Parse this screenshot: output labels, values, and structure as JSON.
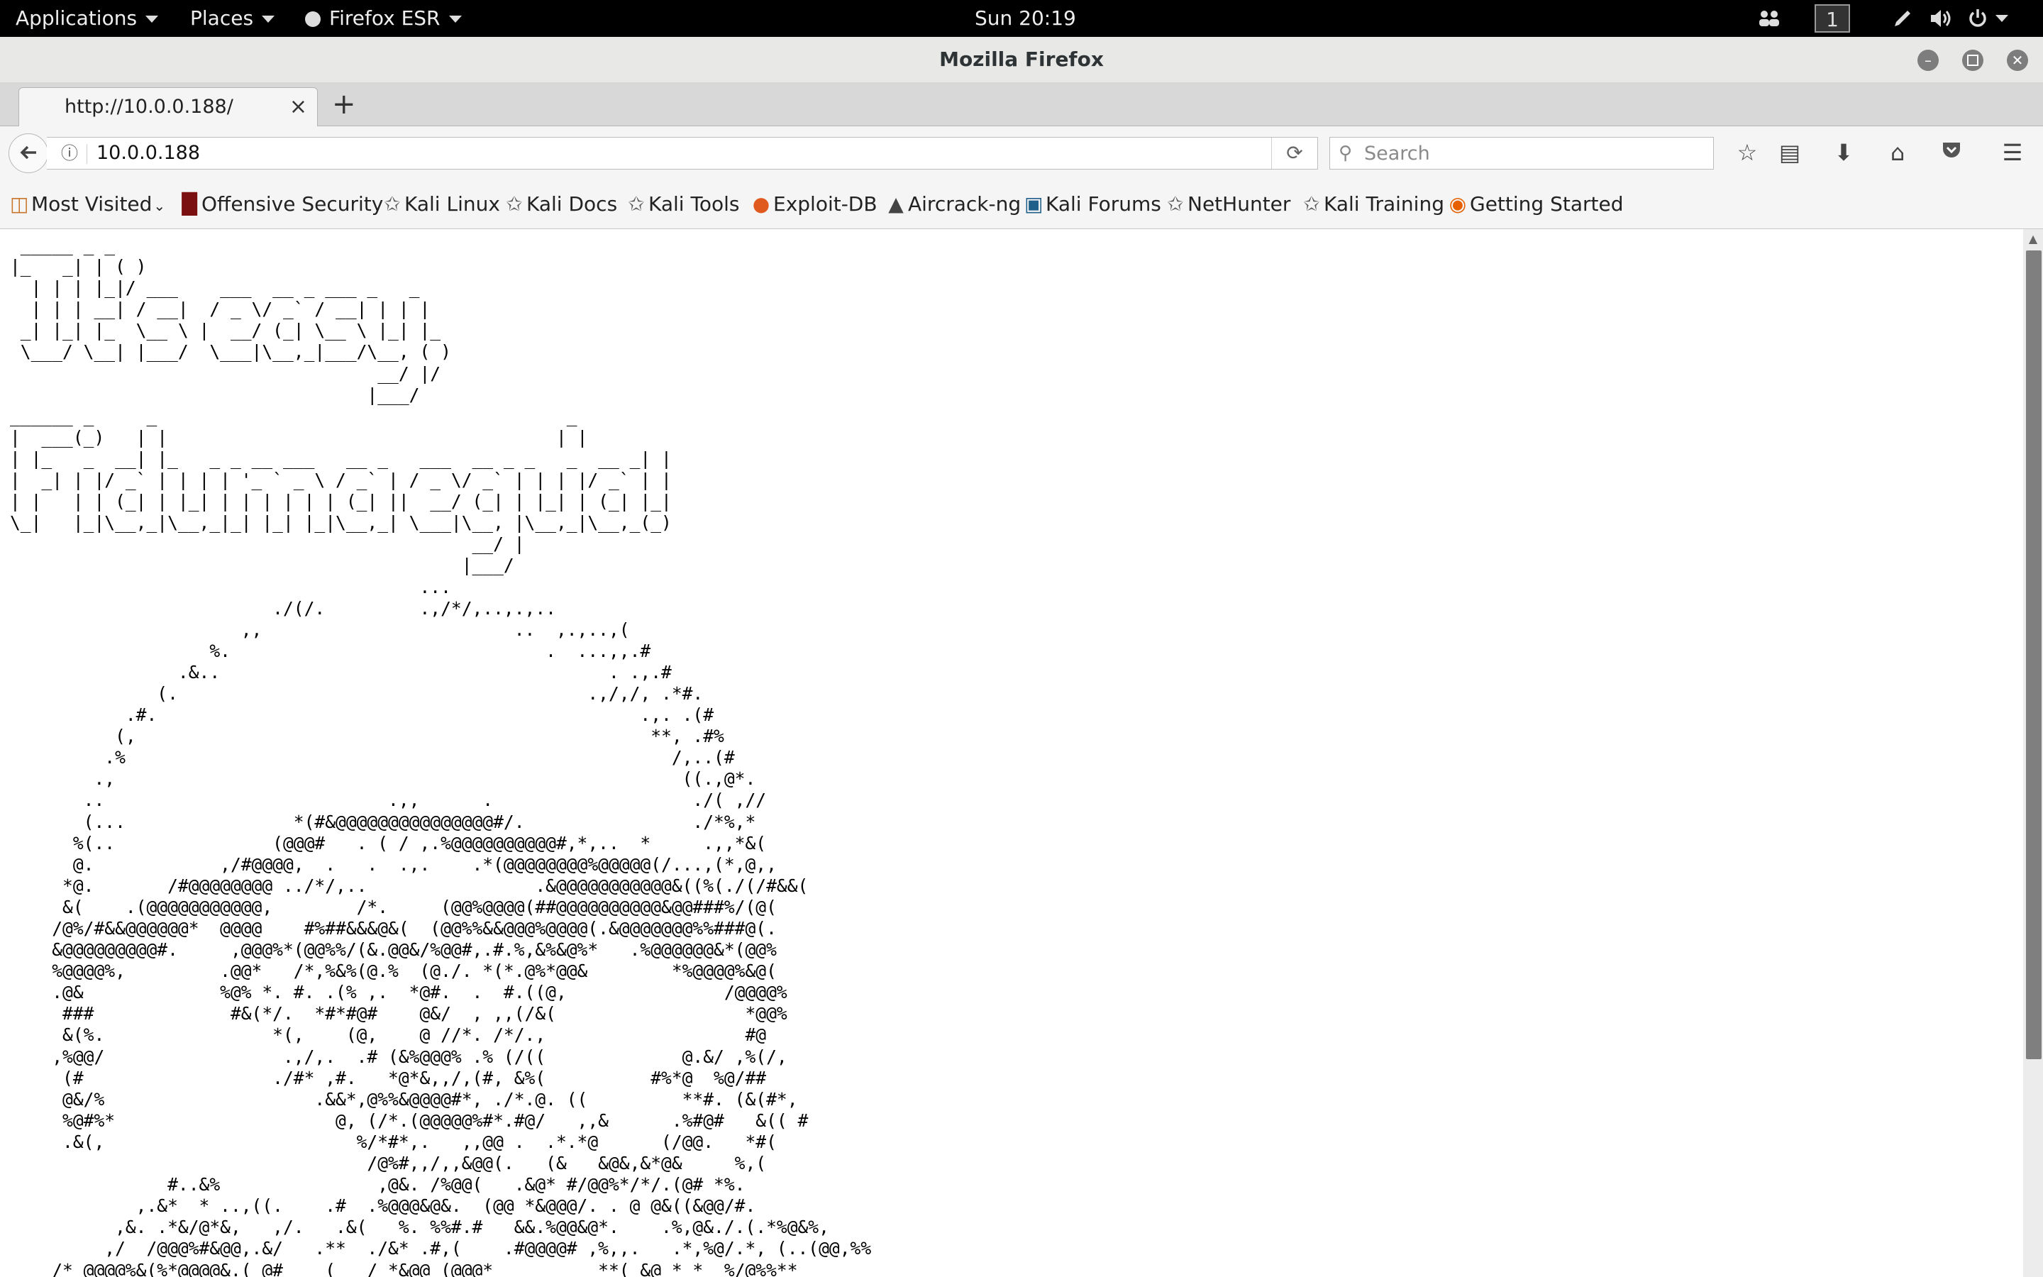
{
  "topbar": {
    "applications": "Applications",
    "places": "Places",
    "firefox_menu": "Firefox ESR",
    "clock": "Sun 20:19",
    "workspace": "1"
  },
  "window": {
    "title": "Mozilla Firefox"
  },
  "tabs": [
    {
      "label": "http://10.0.0.188/",
      "close": "×"
    }
  ],
  "new_tab": "+",
  "navigation": {
    "url": "10.0.0.188",
    "search_placeholder": "Search"
  },
  "bookmarks": [
    {
      "label": "Most Visited",
      "icon": "folder-icon"
    },
    {
      "label": "Offensive Security",
      "icon": "offsec-icon"
    },
    {
      "label": "Kali Linux",
      "icon": "kali-dragon-icon"
    },
    {
      "label": "Kali Docs",
      "icon": "kali-dragon-icon"
    },
    {
      "label": "Kali Tools",
      "icon": "kali-dragon-icon"
    },
    {
      "label": "Exploit-DB",
      "icon": "exploitdb-icon"
    },
    {
      "label": "Aircrack-ng",
      "icon": "aircrack-icon"
    },
    {
      "label": "Kali Forums",
      "icon": "kali-forums-icon"
    },
    {
      "label": "NetHunter",
      "icon": "kali-dragon-icon"
    },
    {
      "label": "Kali Training",
      "icon": "kali-dragon-icon"
    },
    {
      "label": "Getting Started",
      "icon": "firefox-icon"
    }
  ],
  "page": {
    "ascii_art": " _____ _ _\n|_   _| | ( )\n  | | | |_|/ ___    ___  __ _ ___ _   _\n  | | | __| / __|  / _ \\/ _` / __| | | |\n _| |_| |_  \\__ \\ |  __/ (_| \\__ \\ |_| |_\n \\___/ \\__| |___/  \\___|\\__,_|___/\\__, ( )\n                                   __/ |/\n                                  |___/\n______ _     _                                       _\n|  ___(_)   | |                                     | |\n| |_   _  __| |_   _ _ __ ___   __ _   ___  __ _ _   _  __ _| |\n|  _| | |/ _` | | | | '_ ` _ \\ / _` | / _ \\/ _` | | | |/ _` | |\n| |   | | (_| | |_| | | | | | | (_| ||  __/ (_| | |_| | (_| |_|\n\\_|   |_|\\__,_|\\__,_|_| |_| |_|\\__,_| \\___|\\__, |\\__,_|\\__,_(_)\n                                            __/ |\n                                           |___/\n                                       ...\n                         ./(/.         .,/*/,..,.,..\n                      ,,                        ..  ,.,..,(\n                   %.                              .  ...,,.#\n                .&..                                     . .,.#\n              (.                                       .,/,/, .*#.\n           .#.                                              .,. .(#\n          (,                                                 **, .#%\n         .%                                                    /,..(#\n        .,                                                      ((.,@*.\n       ..                           .,,      .                   ./( ,//\n       (...                *(#&@@@@@@@@@@@@@@@#/.                ./*%,*\n      %(..               (@@@#   . ( / ,.%@@@@@@@@@@#,*,..  *     .,,*&(\n      @.            ,/#@@@@,  .   .  .,.    .*(@@@@@@@@%@@@@@(/...,(*,@,,\n     *@.       /#@@@@@@@@ ../*/,..                .&@@@@@@@@@@@&((%(./(/#&&(\n     &(    .(@@@@@@@@@@@,        /*.     (@@%@@@@(##@@@@@@@@@@&@@###%/(@(\n    /@%/#&&@@@@@@*  @@@@    #%##&&&@&(  (@@%%&&@@@%@@@@(.&@@@@@@@%%###@(.\n    &@@@@@@@@@#.     ,@@@%*(@@%%/(&.@@&/%@@#,.#.%,&%&@%*   .%@@@@@@&*(@@%\n    %@@@@%,         .@@*   /*,%&%(@.%  (@./. *(*.@%*@@&        *%@@@@%&@(\n    .@&             %@% *. #. .(% ,.  *@#.  .  #.((@,               /@@@@%\n     ###             #&(*/.  *#*#@#    @&/  , ,,(/&(                  *@@%\n     &(%.                *(,    (@,    @ //*. /*/.,                   #@\n    ,%@@/                 .,/,.  .# (&%@@@% .% (/((             @.&/ ,%(/,\n     (#                  ./#* ,#.   *@*&,,/,(#, &%(          #%*@  %@/##\n     @&/%                    .&&*,@%%&@@@@#*, ./*.@. ((         **#. (&(#*,\n     %@#%*                     @, (/*.(@@@@@%#*.#@/   ,,&      .%#@#   &(( #\n     .&(,                        %/*#*,.   ,,@@ .  .*.*@      (/@@.   *#(\n                                  /@%#,,/,,&@@(.   (&   &@&,&*@&     %,(\n               #..&%               ,@&. /%@@(   .&@* #/@@%*/*/.(@# *%.\n            ,.&*  * ..,((.    .#  .%@@@&@&.  (@@ *&@@@/. . @ @&((&@@/#.\n          ,&. .*&/@*&,   ,/.   .&(   %. %%#.#   &&.%@@&@*.    .%,@&./.(.*%@&%,\n         ,/  /@@@%#&@@,.&/   .**  ./&* .#,(    .#@@@@# ,%,,.   .*,%@/.*, (..(@@,%%\n    /* @@@@%&(%*@@@@&.( @#    (   / *&@@ (@@@*          **( &@ * *  %/@%%**"
  }
}
